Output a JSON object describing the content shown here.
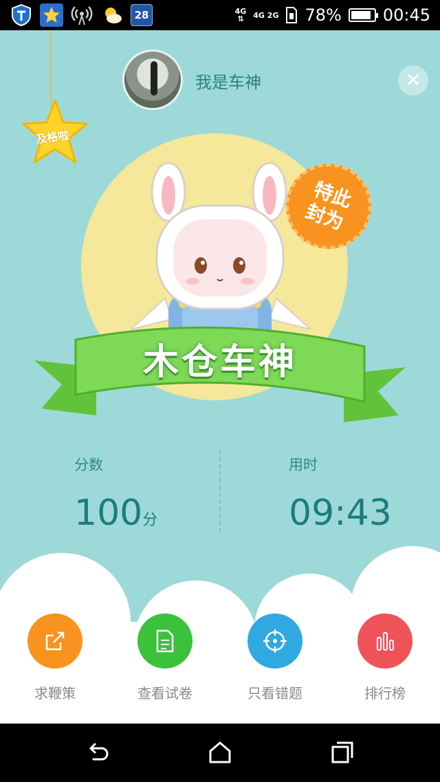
{
  "status_bar": {
    "icons": [
      "shield-icon",
      "star-app-icon",
      "wireless-icon",
      "weather-icon",
      "calendar-icon"
    ],
    "calendar_day": "28",
    "network_top": "4G",
    "network_2g": "4G 2G",
    "battery_percent": "78%",
    "battery_level": 0.78,
    "time": "00:45"
  },
  "user": {
    "name": "我是车神",
    "star_badge": "及格啦"
  },
  "result": {
    "badge": "特此封为",
    "title": "木仓车神"
  },
  "stats": {
    "score_label": "分数",
    "score_value": "100",
    "score_unit": "分",
    "time_label": "用时",
    "time_value": "09:43"
  },
  "actions": [
    {
      "label": "求鞭策",
      "icon": "share-icon",
      "color": "#f7931e"
    },
    {
      "label": "查看试卷",
      "icon": "document-icon",
      "color": "#3cc13c"
    },
    {
      "label": "只看错题",
      "icon": "target-icon",
      "color": "#2fa9e0"
    },
    {
      "label": "排行榜",
      "icon": "bar-chart-icon",
      "color": "#f0525a"
    }
  ],
  "colors": {
    "background": "#9ed9d9",
    "accent_text": "#1b7c7d"
  }
}
